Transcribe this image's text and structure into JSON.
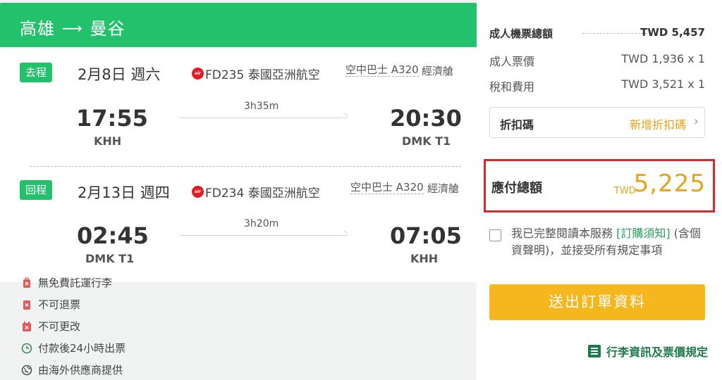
{
  "route": {
    "origin": "高雄",
    "arrow": "⟶",
    "destination": "曼谷"
  },
  "segments": [
    {
      "tag": "去程",
      "date": "2月8日 週六",
      "flight": "FD235 泰國亞洲航空",
      "aircraft": "空中巴士 A320",
      "cabin": "經濟艙",
      "dep_time": "17:55",
      "dep_airport": "KHH",
      "duration": "3h35m",
      "arr_time": "20:30",
      "arr_airport": "DMK T1"
    },
    {
      "tag": "回程",
      "date": "2月13日 週四",
      "flight": "FD234 泰國亞洲航空",
      "aircraft": "空中巴士 A320",
      "cabin": "經濟艙",
      "dep_time": "02:45",
      "dep_airport": "DMK T1",
      "duration": "3h20m",
      "arr_time": "07:05",
      "arr_airport": "KHH"
    }
  ],
  "notes": [
    {
      "icon": "no-baggage-icon",
      "text": "無免費託運行李"
    },
    {
      "icon": "no-refund-icon",
      "text": "不可退票"
    },
    {
      "icon": "no-change-icon",
      "text": "不可更改"
    },
    {
      "icon": "clock-icon",
      "text": "付款後24小時出票"
    },
    {
      "icon": "globe-icon",
      "text": "由海外供應商提供"
    }
  ],
  "pricing": {
    "total_label": "成人機票總額",
    "total_value": "TWD 5,457",
    "fare_label": "成人票價",
    "fare_value": "TWD 1,936 x 1",
    "tax_label": "稅和費用",
    "tax_value": "TWD 3,521 x 1"
  },
  "discount": {
    "label": "折扣碼",
    "action": "新增折扣碼"
  },
  "payable": {
    "label": "應付總額",
    "currency": "TWD",
    "amount": "5,225"
  },
  "agreement": {
    "prefix": "我已完整閱讀本服務 ",
    "link": "[訂購須知]",
    "suffix": " (含個資聲明)，並接受所有規定事項"
  },
  "submit_label": "送出訂單資料",
  "baggage_link": "行李資訊及票價規定",
  "colors": {
    "brand_green": "#23c16b",
    "accent_orange": "#e4a31c",
    "submit_yellow": "#f6b61e",
    "highlight_red": "#d12a2f"
  }
}
